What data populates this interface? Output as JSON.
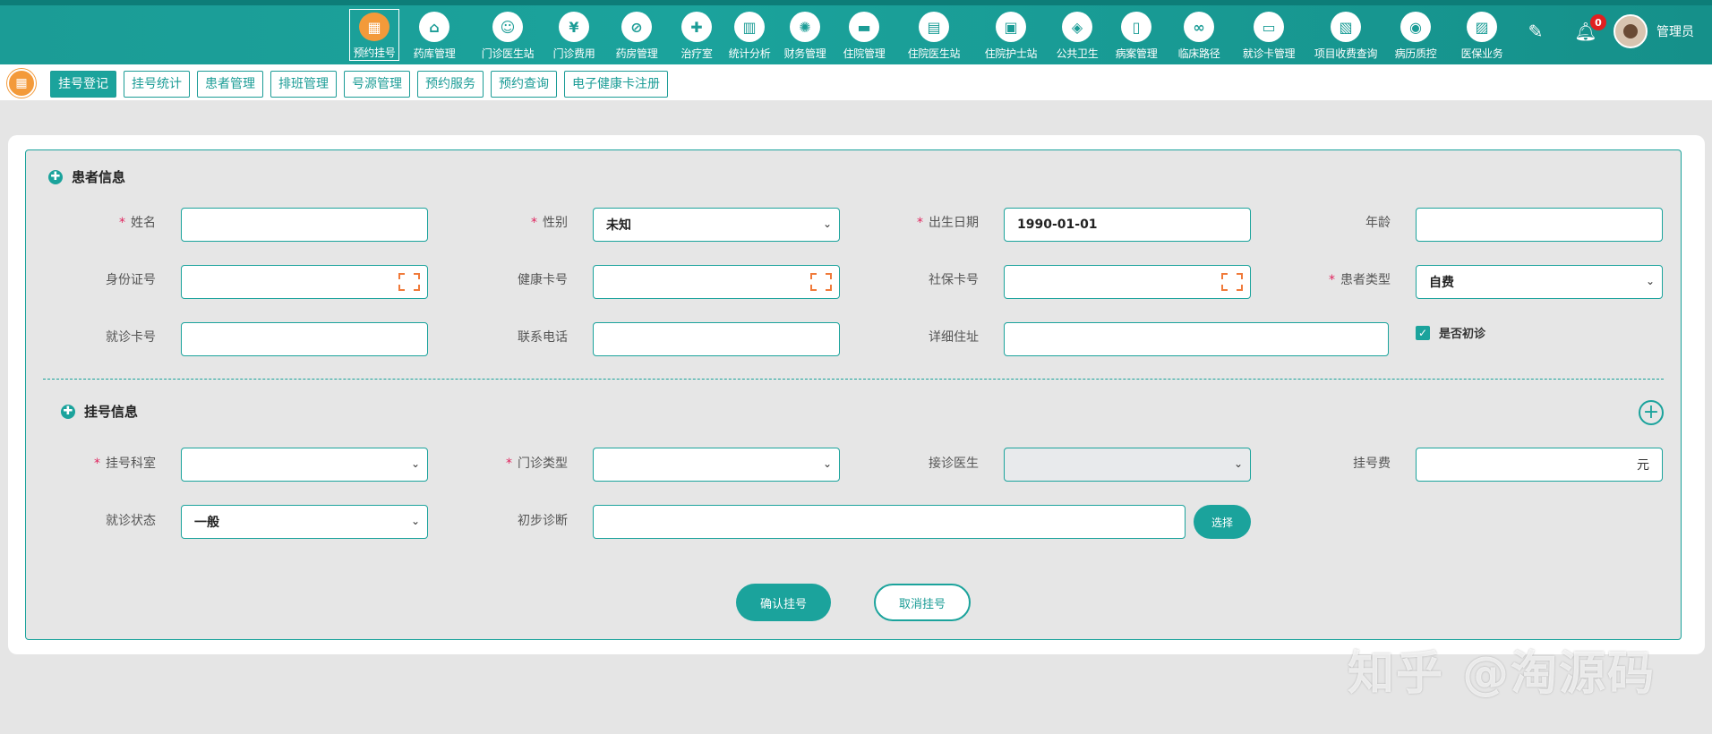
{
  "nav": {
    "items": [
      {
        "label": "预约挂号",
        "icon": "calendar-icon",
        "glyph": "▦"
      },
      {
        "label": "药库管理",
        "icon": "pharmacy-house-icon",
        "glyph": "⌂"
      },
      {
        "label": "门诊医生站",
        "icon": "doctor-icon",
        "glyph": "☺"
      },
      {
        "label": "门诊费用",
        "icon": "yen-icon",
        "glyph": "¥"
      },
      {
        "label": "药房管理",
        "icon": "pill-icon",
        "glyph": "⊘"
      },
      {
        "label": "治疗室",
        "icon": "nurse-icon",
        "glyph": "✚"
      },
      {
        "label": "统计分析",
        "icon": "bar-chart-icon",
        "glyph": "▥"
      },
      {
        "label": "财务管理",
        "icon": "gear-money-icon",
        "glyph": "✺"
      },
      {
        "label": "住院管理",
        "icon": "bed-icon",
        "glyph": "▬"
      },
      {
        "label": "住院医生站",
        "icon": "doctor-card-icon",
        "glyph": "▤"
      },
      {
        "label": "住院护士站",
        "icon": "nurse-card-icon",
        "glyph": "▣"
      },
      {
        "label": "公共卫生",
        "icon": "public-health-icon",
        "glyph": "◈"
      },
      {
        "label": "病案管理",
        "icon": "case-file-icon",
        "glyph": "▯"
      },
      {
        "label": "临床路径",
        "icon": "path-icon",
        "glyph": "∞"
      },
      {
        "label": "就诊卡管理",
        "icon": "card-icon",
        "glyph": "▭"
      },
      {
        "label": "项目收费查询",
        "icon": "invoice-icon",
        "glyph": "▧"
      },
      {
        "label": "病历质控",
        "icon": "record-qc-icon",
        "glyph": "◉"
      },
      {
        "label": "医保业务",
        "icon": "insurance-icon",
        "glyph": "▨"
      }
    ],
    "notifications": "0",
    "username": "管理员"
  },
  "subtabs": [
    "挂号登记",
    "挂号统计",
    "患者管理",
    "排班管理",
    "号源管理",
    "预约服务",
    "预约查询",
    "电子健康卡注册"
  ],
  "patient": {
    "title": "患者信息",
    "name_label": "姓名",
    "name_value": "",
    "gender_label": "性别",
    "gender_value": "未知",
    "birth_label": "出生日期",
    "birth_value": "1990-01-01",
    "age_label": "年龄",
    "age_value": "",
    "id_label": "身份证号",
    "id_value": "",
    "health_card_label": "健康卡号",
    "health_card_value": "",
    "social_card_label": "社保卡号",
    "social_card_value": "",
    "type_label": "患者类型",
    "type_value": "自费",
    "visit_card_label": "就诊卡号",
    "visit_card_value": "",
    "phone_label": "联系电话",
    "phone_value": "",
    "address_label": "详细住址",
    "address_value": "",
    "first_visit_label": "是否初诊",
    "first_visit_checked": true
  },
  "register": {
    "title": "挂号信息",
    "dept_label": "挂号科室",
    "dept_value": "",
    "clinic_type_label": "门诊类型",
    "clinic_type_value": "",
    "doctor_label": "接诊医生",
    "doctor_value": "",
    "fee_label": "挂号费",
    "fee_unit": "元",
    "status_label": "就诊状态",
    "status_value": "一般",
    "diagnosis_label": "初步诊断",
    "diagnosis_value": "",
    "select_button": "选择"
  },
  "actions": {
    "confirm": "确认挂号",
    "cancel": "取消挂号"
  },
  "watermark": "知乎 @淘源码"
}
